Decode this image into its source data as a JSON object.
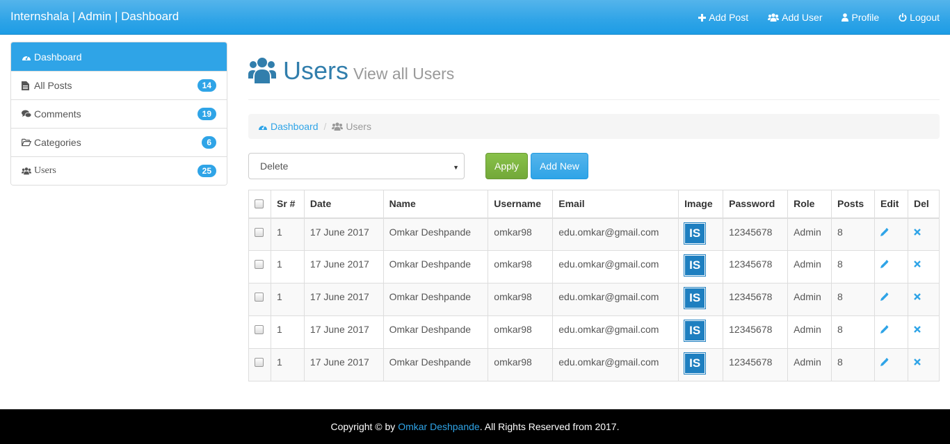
{
  "navbar": {
    "brand": "Internshala | Admin | Dashboard",
    "links": [
      {
        "label": "Add Post",
        "icon": "plus-icon"
      },
      {
        "label": "Add User",
        "icon": "users-icon"
      },
      {
        "label": "Profile",
        "icon": "user-icon"
      },
      {
        "label": "Logout",
        "icon": "power-icon"
      }
    ]
  },
  "sidebar": {
    "items": [
      {
        "label": "Dashboard",
        "icon": "dashboard-icon",
        "active": true
      },
      {
        "label": "All Posts",
        "icon": "file-icon",
        "count": "14"
      },
      {
        "label": "Comments",
        "icon": "comments-icon",
        "count": "19"
      },
      {
        "label": "Categories",
        "icon": "folder-icon",
        "count": "6"
      },
      {
        "label": "Users",
        "icon": "users-icon",
        "count": "25"
      }
    ]
  },
  "header": {
    "title": "Users",
    "subtitle": "View all Users"
  },
  "breadcrumb": {
    "home": "Dashboard",
    "current": "Users"
  },
  "controls": {
    "bulk_action": "Delete",
    "apply_label": "Apply",
    "add_new_label": "Add New"
  },
  "table": {
    "columns": [
      "Sr #",
      "Date",
      "Name",
      "Username",
      "Email",
      "Image",
      "Password",
      "Role",
      "Posts",
      "Edit",
      "Del"
    ],
    "rows": [
      {
        "sr": "1",
        "date": "17 June 2017",
        "name": "Omkar Deshpande",
        "username": "omkar98",
        "email": "edu.omkar@gmail.com",
        "image": "IS",
        "password": "12345678",
        "role": "Admin",
        "posts": "8"
      },
      {
        "sr": "1",
        "date": "17 June 2017",
        "name": "Omkar Deshpande",
        "username": "omkar98",
        "email": "edu.omkar@gmail.com",
        "image": "IS",
        "password": "12345678",
        "role": "Admin",
        "posts": "8"
      },
      {
        "sr": "1",
        "date": "17 June 2017",
        "name": "Omkar Deshpande",
        "username": "omkar98",
        "email": "edu.omkar@gmail.com",
        "image": "IS",
        "password": "12345678",
        "role": "Admin",
        "posts": "8"
      },
      {
        "sr": "1",
        "date": "17 June 2017",
        "name": "Omkar Deshpande",
        "username": "omkar98",
        "email": "edu.omkar@gmail.com",
        "image": "IS",
        "password": "12345678",
        "role": "Admin",
        "posts": "8"
      },
      {
        "sr": "1",
        "date": "17 June 2017",
        "name": "Omkar Deshpande",
        "username": "omkar98",
        "email": "edu.omkar@gmail.com",
        "image": "IS",
        "password": "12345678",
        "role": "Admin",
        "posts": "8"
      }
    ]
  },
  "footer": {
    "prefix": "Copyright © by ",
    "author": "Omkar Deshpande",
    "suffix": ". All Rights Reserved from 2017."
  },
  "colors": {
    "primary": "#2fa4e7",
    "success": "#73a839",
    "footer_bg": "#000000"
  }
}
